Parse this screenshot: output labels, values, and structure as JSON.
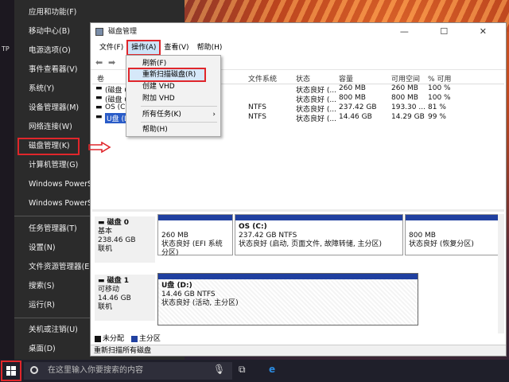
{
  "winx_menu": {
    "items": [
      {
        "label": "应用和功能(F)"
      },
      {
        "label": "移动中心(B)"
      },
      {
        "label": "电源选项(O)"
      },
      {
        "label": "事件查看器(V)"
      },
      {
        "label": "系统(Y)"
      },
      {
        "label": "设备管理器(M)"
      },
      {
        "label": "网络连接(W)"
      },
      {
        "label": "磁盘管理(K)"
      },
      {
        "label": "计算机管理(G)"
      },
      {
        "label": "Windows PowerShell"
      },
      {
        "label": "Windows PowerShell"
      },
      {
        "label": "任务管理器(T)"
      },
      {
        "label": "设置(N)"
      },
      {
        "label": "文件资源管理器(E)"
      },
      {
        "label": "搜索(S)"
      },
      {
        "label": "运行(R)"
      },
      {
        "label": "关机或注销(U)"
      },
      {
        "label": "桌面(D)"
      }
    ],
    "edge_text": "TP"
  },
  "window": {
    "title": "磁盘管理",
    "controls": "—  ☐  ✕",
    "menu": [
      "文件(F)",
      "操作(A)",
      "查看(V)",
      "帮助(H)"
    ]
  },
  "table": {
    "headers": [
      "卷",
      "文件系统",
      "状态",
      "容量",
      "可用空间",
      "% 可用"
    ],
    "rows": [
      {
        "vol": "(磁盘 0",
        "fs": "",
        "status": "状态良好 (...",
        "cap": "260 MB",
        "free": "260 MB",
        "pct": "100 %"
      },
      {
        "vol": "(磁盘 0",
        "fs": "",
        "status": "状态良好 (...",
        "cap": "800 MB",
        "free": "800 MB",
        "pct": "100 %"
      },
      {
        "vol": "OS (C:",
        "fs": "NTFS",
        "status": "状态良好 (...",
        "cap": "237.42 GB",
        "free": "193.30 ...",
        "pct": "81 %"
      },
      {
        "vol": "U盘 (D:",
        "fs": "NTFS",
        "status": "状态良好 (...",
        "cap": "14.46 GB",
        "free": "14.29 GB",
        "pct": "99 %"
      }
    ]
  },
  "dropdown": {
    "items": [
      "刷新(F)",
      "重新扫描磁盘(R)",
      "创建 VHD",
      "附加 VHD",
      "所有任务(K)",
      "帮助(H)"
    ],
    "submenu_arrow": "›"
  },
  "disks": [
    {
      "name": "磁盘 0",
      "type": "基本",
      "size": "238.46 GB",
      "state": "联机",
      "partitions": [
        {
          "title": "",
          "size": "260 MB",
          "status": "状态良好 (EFI 系统分区)"
        },
        {
          "title": "OS  (C:)",
          "size": "237.42 GB NTFS",
          "status": "状态良好 (启动, 页面文件, 故障转储, 主分区)"
        },
        {
          "title": "",
          "size": "800 MB",
          "status": "状态良好 (恢复分区)"
        }
      ]
    },
    {
      "name": "磁盘 1",
      "type": "可移动",
      "size": "14.46 GB",
      "state": "联机",
      "partitions": [
        {
          "title": "U盘  (D:)",
          "size": "14.46 GB NTFS",
          "status": "状态良好 (活动, 主分区)"
        }
      ]
    }
  ],
  "legend": [
    "未分配",
    "主分区"
  ],
  "statusbar": "重新扫描所有磁盘",
  "taskbar": {
    "search_placeholder": "在这里输入你要搜索的内容"
  },
  "colors": {
    "highlight_red": "#e0262b",
    "partition_bar": "#2040a0",
    "menu_bg": "#2b2b2b"
  }
}
